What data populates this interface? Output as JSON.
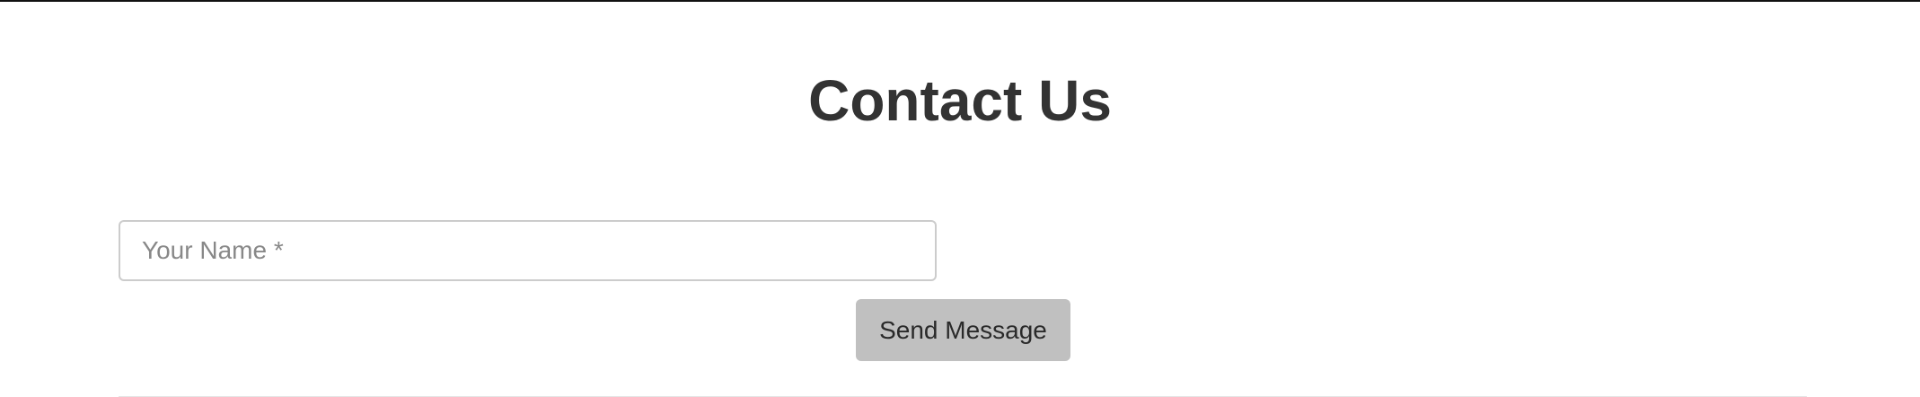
{
  "page": {
    "title": "Contact Us"
  },
  "form": {
    "name_placeholder": "Your Name *",
    "name_value": "",
    "submit_label": "Send Message"
  },
  "colors": {
    "title": "#333333",
    "button_bg": "#c0c0c0",
    "input_border": "#cccccc",
    "placeholder": "#888888"
  }
}
